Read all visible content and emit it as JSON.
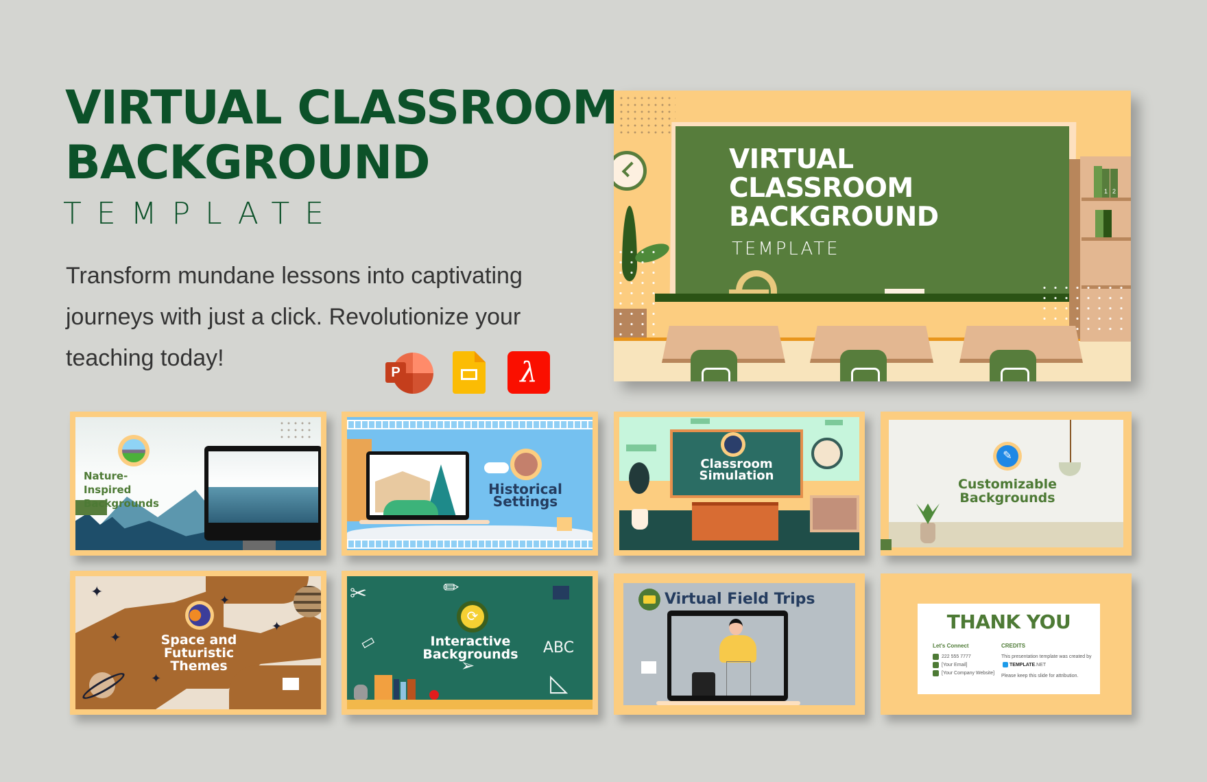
{
  "header": {
    "title_line1": "VIRTUAL CLASSROOM",
    "title_line2": "BACKGROUND",
    "subtitle": "TEMPLATE",
    "description": "Transform mundane lessons into captivating journeys with just a click. Revolutionize your teaching today!"
  },
  "formats": [
    {
      "name": "PowerPoint",
      "icon": "powerpoint-icon",
      "glyph": "P",
      "color": "#c43e1c"
    },
    {
      "name": "Google Slides",
      "icon": "google-slides-icon",
      "color": "#fbbc04"
    },
    {
      "name": "Adobe PDF",
      "icon": "adobe-pdf-icon",
      "glyph": "λ",
      "color": "#fa0f00"
    }
  ],
  "hero": {
    "title_line1": "VIRTUAL",
    "title_line2": "CLASSROOM",
    "title_line3": "BACKGROUND",
    "subtitle": "TEMPLATE",
    "book_labels": [
      "1",
      "2"
    ]
  },
  "slides": [
    {
      "title_line1": "Nature-Inspired",
      "title_line2": "Backgrounds",
      "icon": "landscape-icon",
      "title_color": "#4d7a35"
    },
    {
      "title_line1": "Historical",
      "title_line2": "Settings",
      "icon": "colosseum-icon",
      "title_color": "#243c5f"
    },
    {
      "title_line1": "Classroom",
      "title_line2": "Simulation",
      "icon": "chalkboard-icon",
      "title_color": "#ffffff"
    },
    {
      "title_line1": "Customizable",
      "title_line2": "Backgrounds",
      "icon": "pencil-icon",
      "title_color": "#4d7a35"
    },
    {
      "title_line1": "Space and",
      "title_line2": "Futuristic",
      "title_line3": "Themes",
      "icon": "solar-system-icon",
      "title_color": "#ffffff"
    },
    {
      "title_line1": "Interactive",
      "title_line2": "Backgrounds",
      "icon": "refresh-icon",
      "doodle_text": "ABC",
      "title_color": "#ffffff"
    },
    {
      "title": "Virtual Field Trips",
      "icon": "bus-icon",
      "title_color": "#243c5f"
    },
    {
      "title": "THANK YOU",
      "connect_heading": "Let's Connect",
      "phone": "222 555 7777",
      "email": "[Your Email]",
      "website": "[Your Company Website]",
      "credits_heading": "CREDITS",
      "credits_text": "This presentation template was created by",
      "credits_brand": "TEMPLATE",
      "credits_brand_suffix": ".NET",
      "attribution": "Please keep this slide for attribution."
    }
  ],
  "colors": {
    "background": "#d4d5d1",
    "title_green": "#0c5129",
    "frame_orange": "#fccd80",
    "board_green": "#577d3c"
  }
}
